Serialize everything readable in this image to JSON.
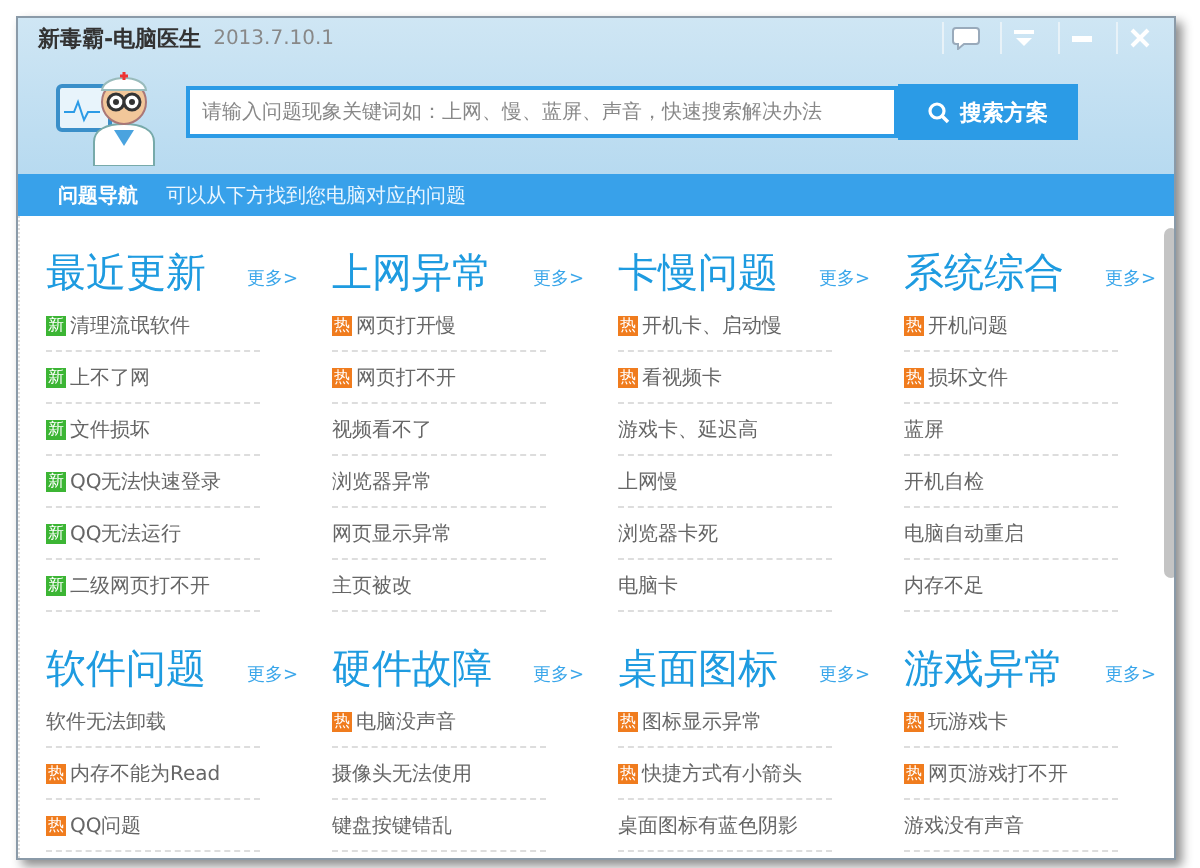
{
  "window": {
    "title": "新毒霸-电脑医生",
    "version": "2013.7.10.1"
  },
  "search": {
    "placeholder": "请输入问题现象关键词如：上网、慢、蓝屏、声音，快速搜索解决办法",
    "button": "搜索方案"
  },
  "nav": {
    "label": "问题导航",
    "hint": "可以从下方找到您电脑对应的问题"
  },
  "sections": [
    {
      "title": "最近更新",
      "more": "更多>",
      "items": [
        {
          "badge": {
            "kind": "new",
            "text": "新"
          },
          "text": "清理流氓软件"
        },
        {
          "badge": {
            "kind": "new",
            "text": "新"
          },
          "text": "上不了网"
        },
        {
          "badge": {
            "kind": "new",
            "text": "新"
          },
          "text": "文件损坏"
        },
        {
          "badge": {
            "kind": "new",
            "text": "新"
          },
          "text": "QQ无法快速登录"
        },
        {
          "badge": {
            "kind": "new",
            "text": "新"
          },
          "text": "QQ无法运行"
        },
        {
          "badge": {
            "kind": "new",
            "text": "新"
          },
          "text": "二级网页打不开"
        }
      ]
    },
    {
      "title": "上网异常",
      "more": "更多>",
      "items": [
        {
          "badge": {
            "kind": "hot",
            "text": "热"
          },
          "text": "网页打开慢"
        },
        {
          "badge": {
            "kind": "hot",
            "text": "热"
          },
          "text": "网页打不开"
        },
        {
          "text": "视频看不了"
        },
        {
          "text": "浏览器异常"
        },
        {
          "text": "网页显示异常"
        },
        {
          "text": "主页被改"
        }
      ]
    },
    {
      "title": "卡慢问题",
      "more": "更多>",
      "items": [
        {
          "badge": {
            "kind": "hot",
            "text": "热"
          },
          "text": "开机卡、启动慢"
        },
        {
          "badge": {
            "kind": "hot",
            "text": "热"
          },
          "text": "看视频卡"
        },
        {
          "text": "游戏卡、延迟高"
        },
        {
          "text": "上网慢"
        },
        {
          "text": "浏览器卡死"
        },
        {
          "text": "电脑卡"
        }
      ]
    },
    {
      "title": "系统综合",
      "more": "更多>",
      "items": [
        {
          "badge": {
            "kind": "hot",
            "text": "热"
          },
          "text": "开机问题"
        },
        {
          "badge": {
            "kind": "hot",
            "text": "热"
          },
          "text": "损坏文件"
        },
        {
          "text": "蓝屏"
        },
        {
          "text": "开机自检"
        },
        {
          "text": "电脑自动重启"
        },
        {
          "text": "内存不足"
        }
      ]
    },
    {
      "title": "软件问题",
      "more": "更多>",
      "items": [
        {
          "text": "软件无法卸载"
        },
        {
          "badge": {
            "kind": "hot",
            "text": "热"
          },
          "text": "内存不能为Read"
        },
        {
          "badge": {
            "kind": "hot",
            "text": "热"
          },
          "text": "QQ问题"
        }
      ]
    },
    {
      "title": "硬件故障",
      "more": "更多>",
      "items": [
        {
          "badge": {
            "kind": "hot",
            "text": "热"
          },
          "text": "电脑没声音"
        },
        {
          "text": "摄像头无法使用"
        },
        {
          "text": "键盘按键错乱"
        }
      ]
    },
    {
      "title": "桌面图标",
      "more": "更多>",
      "items": [
        {
          "badge": {
            "kind": "hot",
            "text": "热"
          },
          "text": "图标显示异常"
        },
        {
          "badge": {
            "kind": "hot",
            "text": "热"
          },
          "text": "快捷方式有小箭头"
        },
        {
          "text": "桌面图标有蓝色阴影"
        }
      ]
    },
    {
      "title": "游戏异常",
      "more": "更多>",
      "items": [
        {
          "badge": {
            "kind": "hot",
            "text": "热"
          },
          "text": "玩游戏卡"
        },
        {
          "badge": {
            "kind": "hot",
            "text": "热"
          },
          "text": "网页游戏打不开"
        },
        {
          "text": "游戏没有声音"
        }
      ]
    }
  ]
}
